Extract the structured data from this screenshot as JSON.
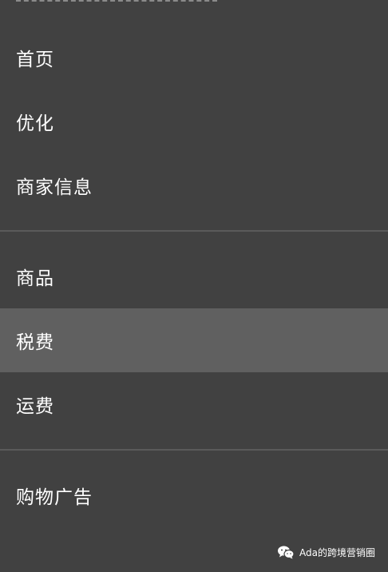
{
  "menu": {
    "items": [
      {
        "label": "首页"
      },
      {
        "label": "优化"
      },
      {
        "label": "商家信息"
      },
      {
        "label": "商品"
      },
      {
        "label": "税费",
        "active": true
      },
      {
        "label": "运费"
      },
      {
        "label": "购物广告"
      }
    ]
  },
  "watermark": {
    "text": "Ada的跨境营销圈",
    "icon": "wechat-icon"
  },
  "colors": {
    "background": "#414141",
    "active_background": "#606060",
    "divider": "#5a5a5a",
    "text": "#ffffff"
  }
}
